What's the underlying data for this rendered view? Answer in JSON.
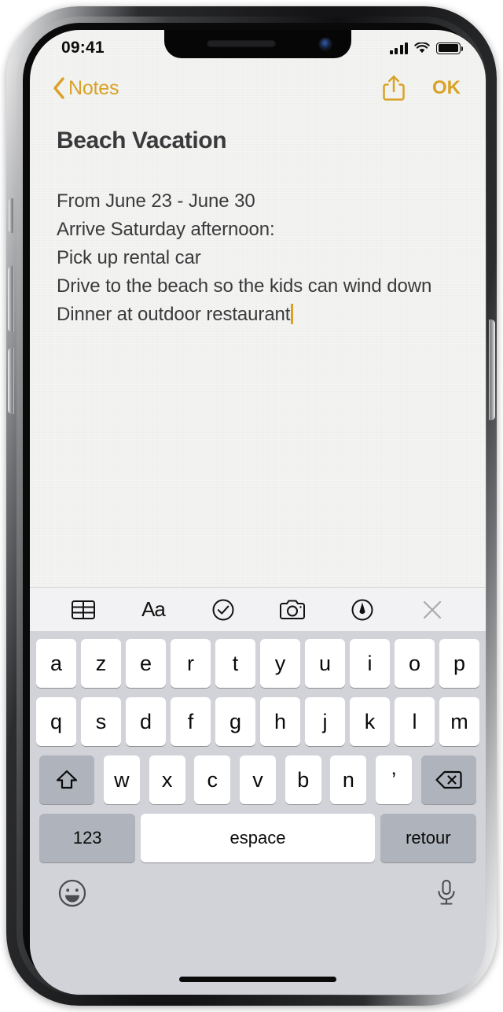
{
  "device": {
    "status_bar": {
      "time": "09:41",
      "cellular_icon": "signal-bars-icon",
      "wifi_icon": "wifi-icon",
      "battery_icon": "battery-full-icon",
      "battery_level": 100
    },
    "notch": {
      "speaker_icon": "earpiece-speaker",
      "camera_icon": "front-camera"
    },
    "home_indicator": "home-indicator"
  },
  "nav_bar": {
    "back_label": "Notes",
    "back_icon": "chevron-left-icon",
    "share_icon": "share-icon",
    "done_label": "OK"
  },
  "note": {
    "title": "Beach Vacation",
    "lines": [
      "From June 23 - June 30",
      "Arrive Saturday afternoon:",
      "Pick up rental car",
      "Drive to the beach so the kids can wind down",
      "Dinner at outdoor restaurant"
    ],
    "caret_visible": true
  },
  "format_toolbar": {
    "buttons": [
      {
        "name": "table-icon",
        "label": "Table"
      },
      {
        "name": "text-format-icon",
        "label": "Aa"
      },
      {
        "name": "checklist-icon",
        "label": "Checklist"
      },
      {
        "name": "camera-icon",
        "label": "Camera"
      },
      {
        "name": "markup-pen-icon",
        "label": "Markup"
      },
      {
        "name": "close-icon",
        "label": "Close"
      }
    ]
  },
  "keyboard": {
    "layout": "AZERTY",
    "language": "French",
    "row1": [
      "a",
      "z",
      "e",
      "r",
      "t",
      "y",
      "u",
      "i",
      "o",
      "p"
    ],
    "row2": [
      "q",
      "s",
      "d",
      "f",
      "g",
      "h",
      "j",
      "k",
      "l",
      "m"
    ],
    "row3": [
      "w",
      "x",
      "c",
      "v",
      "b",
      "n",
      "’"
    ],
    "shift_icon": "shift-up-arrow-icon",
    "backspace_icon": "backspace-delete-icon",
    "numbers_label": "123",
    "space_label": "espace",
    "return_label": "retour",
    "emoji_icon": "emoji-smiley-icon",
    "dictation_icon": "microphone-icon"
  },
  "colors": {
    "accent_gold": "#D9A227",
    "note_bg": "#F4F4F2",
    "text": "#3A3A3C",
    "keyboard_bg": "#D1D3D9",
    "key_white": "#FFFFFF",
    "key_gray": "#AFB3BC",
    "toolbar_bg": "#F2F2F4"
  }
}
